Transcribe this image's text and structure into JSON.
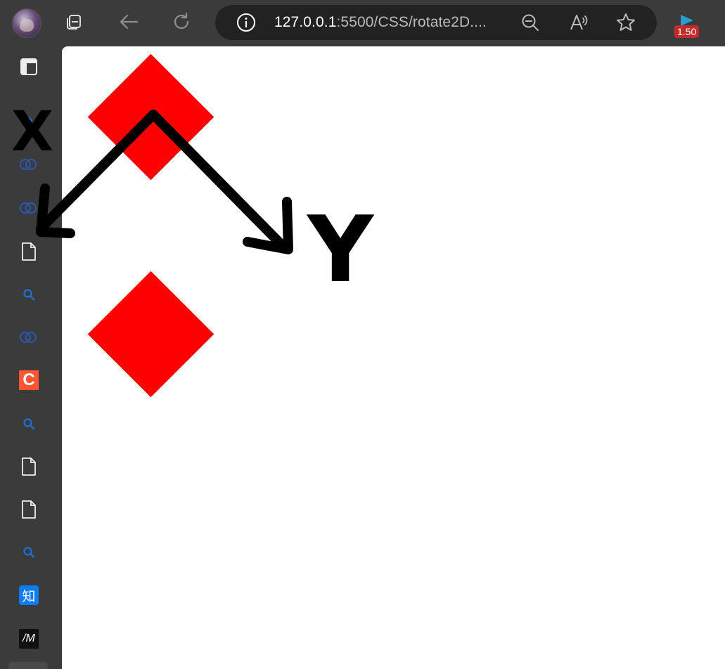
{
  "address_bar": {
    "host": "127.0.0.1",
    "path": ":5500/CSS/rotate2D...."
  },
  "extension": {
    "badge": "1.50"
  },
  "sidebar": {
    "items": [
      {
        "icon": "layout-icon"
      },
      {
        "icon": "search-icon"
      },
      {
        "icon": "circles-icon"
      },
      {
        "icon": "circles-icon"
      },
      {
        "icon": "file-icon"
      },
      {
        "icon": "search-icon"
      },
      {
        "icon": "circles-icon"
      },
      {
        "icon": "c-logo-icon",
        "label": "C"
      },
      {
        "icon": "search-icon"
      },
      {
        "icon": "file-icon"
      },
      {
        "icon": "file-icon"
      },
      {
        "icon": "search-icon"
      },
      {
        "icon": "zhihu-icon",
        "label": "知"
      },
      {
        "icon": "m-logo-icon",
        "label": "/M"
      }
    ]
  },
  "annotations": {
    "x_label": "X",
    "y_label": "Y"
  },
  "colors": {
    "diamond": "#ff0000",
    "chrome": "#3b3b3b",
    "address_bar": "#222222",
    "badge": "#c12b2b",
    "link_blue": "#1e6fd6"
  }
}
